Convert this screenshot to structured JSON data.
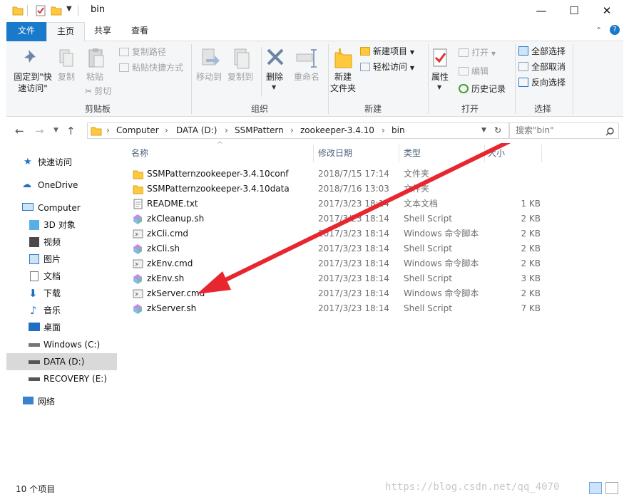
{
  "title": "bin",
  "window_controls": {
    "minimize": "—",
    "maximize": "☐",
    "close": "✕"
  },
  "tabs": [
    {
      "label": "文件"
    },
    {
      "label": "主页"
    },
    {
      "label": "共享"
    },
    {
      "label": "查看"
    }
  ],
  "ribbon": {
    "clipboard": {
      "label": "剪贴板",
      "pin": "固定到\"快\n速访问\"",
      "copy": "复制",
      "paste": "粘贴",
      "copy_path": "复制路径",
      "paste_shortcut": "粘贴快捷方式",
      "cut": "剪切"
    },
    "organize": {
      "label": "组织",
      "move_to": "移动到",
      "copy_to": "复制到",
      "delete": "删除",
      "rename": "重命名"
    },
    "new": {
      "label": "新建",
      "new_folder": "新建\n文件夹",
      "new_item": "新建项目",
      "easy_access": "轻松访问"
    },
    "open": {
      "label": "打开",
      "properties": "属性",
      "open": "打开",
      "edit": "编辑",
      "history": "历史记录"
    },
    "select": {
      "label": "选择",
      "select_all": "全部选择",
      "select_none": "全部取消",
      "invert": "反向选择"
    }
  },
  "address": {
    "crumbs": [
      "Computer",
      "DATA (D:)",
      "SSMPattern",
      "zookeeper-3.4.10",
      "bin"
    ],
    "search_placeholder": "搜索\"bin\""
  },
  "nav": [
    {
      "label": "快速访问",
      "icon": "star-icon"
    },
    {
      "label": "OneDrive",
      "icon": "cloud-icon"
    },
    {
      "label": "Computer",
      "icon": "computer-icon"
    },
    {
      "label": "3D 对象",
      "icon": "cube-icon"
    },
    {
      "label": "视频",
      "icon": "video-icon"
    },
    {
      "label": "图片",
      "icon": "picture-icon"
    },
    {
      "label": "文档",
      "icon": "document-icon"
    },
    {
      "label": "下载",
      "icon": "download-icon"
    },
    {
      "label": "音乐",
      "icon": "music-icon"
    },
    {
      "label": "桌面",
      "icon": "desktop-icon"
    },
    {
      "label": "Windows (C:)",
      "icon": "drive-icon"
    },
    {
      "label": "DATA (D:)",
      "icon": "drive-icon"
    },
    {
      "label": "RECOVERY (E:)",
      "icon": "drive-icon"
    },
    {
      "label": "网络",
      "icon": "network-icon"
    }
  ],
  "columns": {
    "name": "名称",
    "date": "修改日期",
    "type": "类型",
    "size": "大小"
  },
  "files": [
    {
      "name": "SSMPatternzookeeper-3.4.10conf",
      "date": "2018/7/15 17:14",
      "type": "文件夹",
      "size": "",
      "icon": "folder-icon"
    },
    {
      "name": "SSMPatternzookeeper-3.4.10data",
      "date": "2018/7/16 13:03",
      "type": "文件夹",
      "size": "",
      "icon": "folder-icon"
    },
    {
      "name": "README.txt",
      "date": "2017/3/23 18:14",
      "type": "文本文档",
      "size": "1 KB",
      "icon": "text-file-icon"
    },
    {
      "name": "zkCleanup.sh",
      "date": "2017/3/23 18:14",
      "type": "Shell Script",
      "size": "2 KB",
      "icon": "shell-script-icon"
    },
    {
      "name": "zkCli.cmd",
      "date": "2017/3/23 18:14",
      "type": "Windows 命令脚本",
      "size": "2 KB",
      "icon": "cmd-script-icon"
    },
    {
      "name": "zkCli.sh",
      "date": "2017/3/23 18:14",
      "type": "Shell Script",
      "size": "2 KB",
      "icon": "shell-script-icon"
    },
    {
      "name": "zkEnv.cmd",
      "date": "2017/3/23 18:14",
      "type": "Windows 命令脚本",
      "size": "2 KB",
      "icon": "cmd-script-icon"
    },
    {
      "name": "zkEnv.sh",
      "date": "2017/3/23 18:14",
      "type": "Shell Script",
      "size": "3 KB",
      "icon": "shell-script-icon"
    },
    {
      "name": "zkServer.cmd",
      "date": "2017/3/23 18:14",
      "type": "Windows 命令脚本",
      "size": "2 KB",
      "icon": "cmd-script-icon"
    },
    {
      "name": "zkServer.sh",
      "date": "2017/3/23 18:14",
      "type": "Shell Script",
      "size": "7 KB",
      "icon": "shell-script-icon"
    }
  ],
  "status": {
    "item_count": "10 个项目"
  },
  "watermark": "https://blog.csdn.net/qq_4070",
  "colors": {
    "accent": "#1979ca",
    "arrow": "#e8262f",
    "folder": "#ffc83d",
    "selected": "#d9d9d9"
  }
}
